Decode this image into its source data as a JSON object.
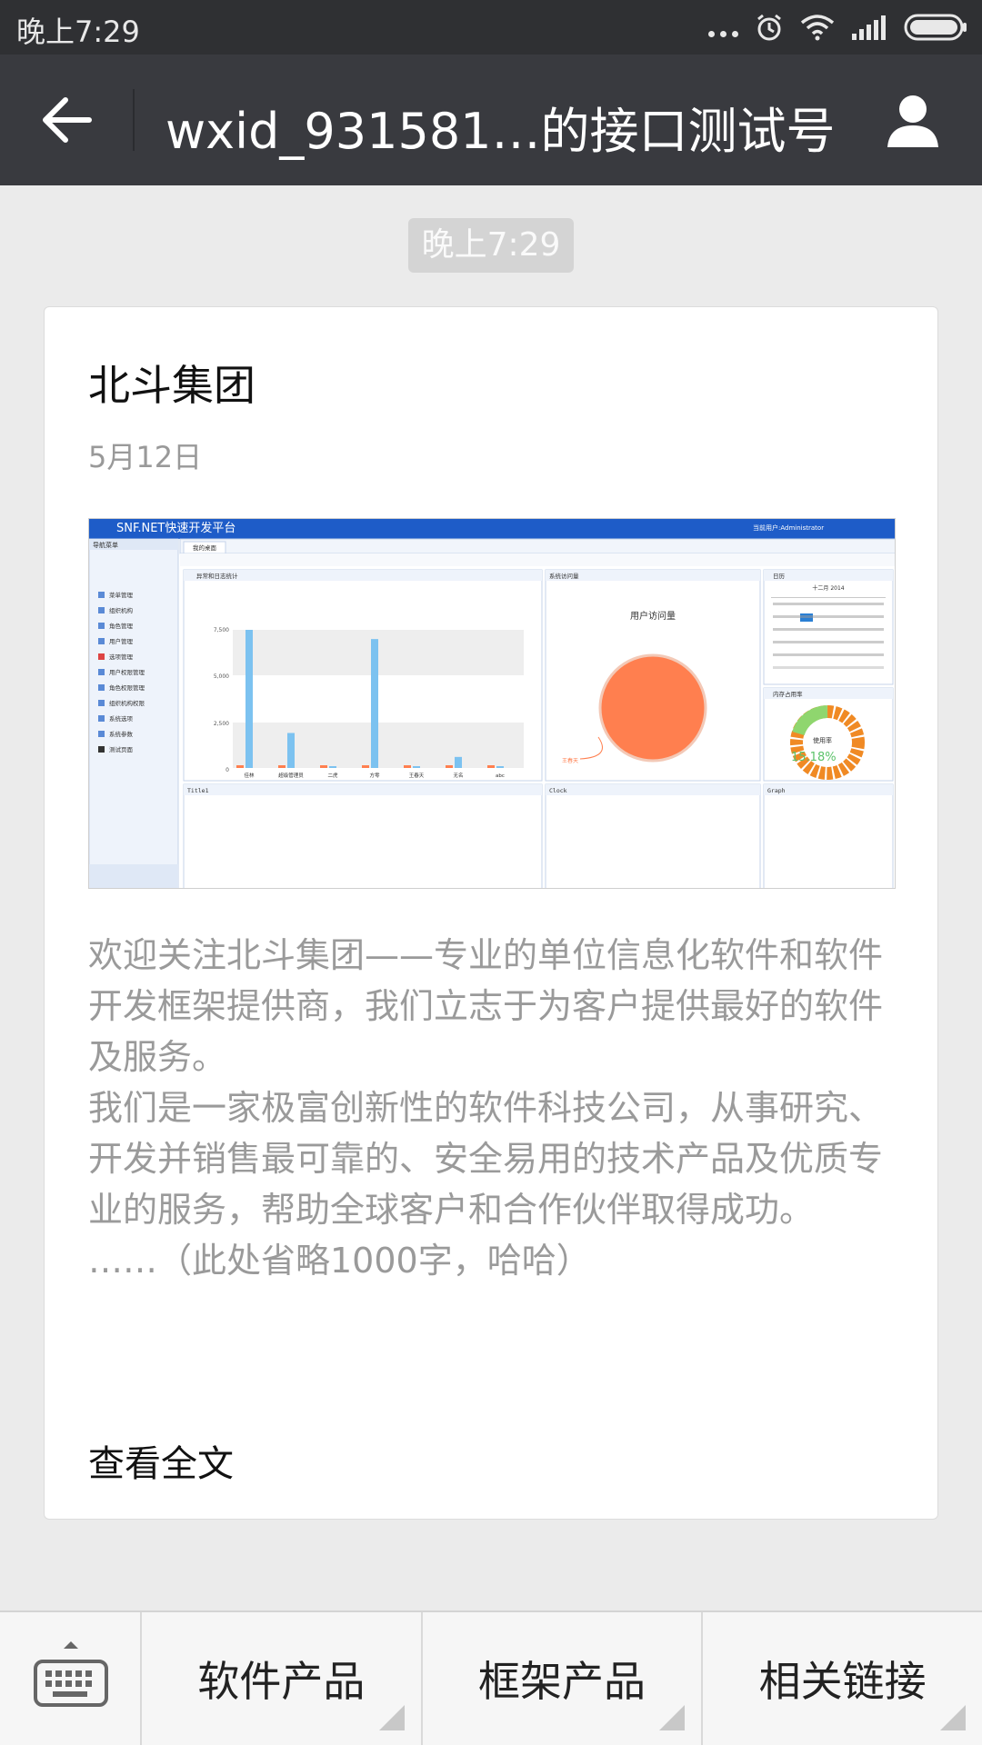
{
  "status_bar": {
    "time": "晚上7:29"
  },
  "header": {
    "title": "wxid_931581…的接口测试号"
  },
  "chat": {
    "timestamp": "晚上7:29"
  },
  "article": {
    "title": "北斗集团",
    "date": "5月12日",
    "paragraphs": [
      "欢迎关注北斗集团——专业的单位信息化软件和软件开发框架提供商，我们立志于为客户提供最好的软件及服务。",
      "我们是一家极富创新性的软件科技公司，从事研究、开发并销售最可靠的、安全易用的技术产品及优质专业的服务，帮助全球客户和合作伙伴取得成功。",
      "……（此处省略1000字，哈哈）"
    ],
    "read_more": "查看全文"
  },
  "thumbnail": {
    "app_title": "SNF.NET快速开发平台",
    "user_label": "当前用户:Administrator",
    "nav_title": "导航菜单",
    "nav_items": [
      "菜单管理",
      "组织机构",
      "角色管理",
      "用户管理",
      "选项管理",
      "用户权限管理",
      "角色权限管理",
      "组织机构权限",
      "系统选项",
      "系统参数",
      "测试页面"
    ],
    "tab_label": "我的桌面",
    "panels": [
      "异常和日志统计",
      "系统访问量",
      "日历",
      "内存占用率",
      "Title1",
      "Clock",
      "Graph"
    ],
    "bar_categories": [
      "佳林",
      "超级管理员",
      "二虎",
      "方零",
      "王春天",
      "无名",
      "abc"
    ],
    "bar_values": [
      7500,
      1900,
      0,
      7000,
      0,
      600,
      0
    ],
    "bar_yticks": [
      "7,500",
      "5,000",
      "2,500",
      "0"
    ],
    "pie_title": "用户访问量",
    "pie_label": "王春天",
    "calendar_header": "十二月 2014",
    "gauge_label": "使用率",
    "gauge_value": "15.18%"
  },
  "menu": {
    "items": [
      "软件产品",
      "框架产品",
      "相关链接"
    ]
  },
  "colors": {
    "status_bar": "#2f3033",
    "header": "#393a3f",
    "background": "#ebebeb",
    "thumb_banner": "#1e5cc8",
    "bar_blue": "#7cc2f0",
    "pie_orange": "#ff7f4f"
  }
}
